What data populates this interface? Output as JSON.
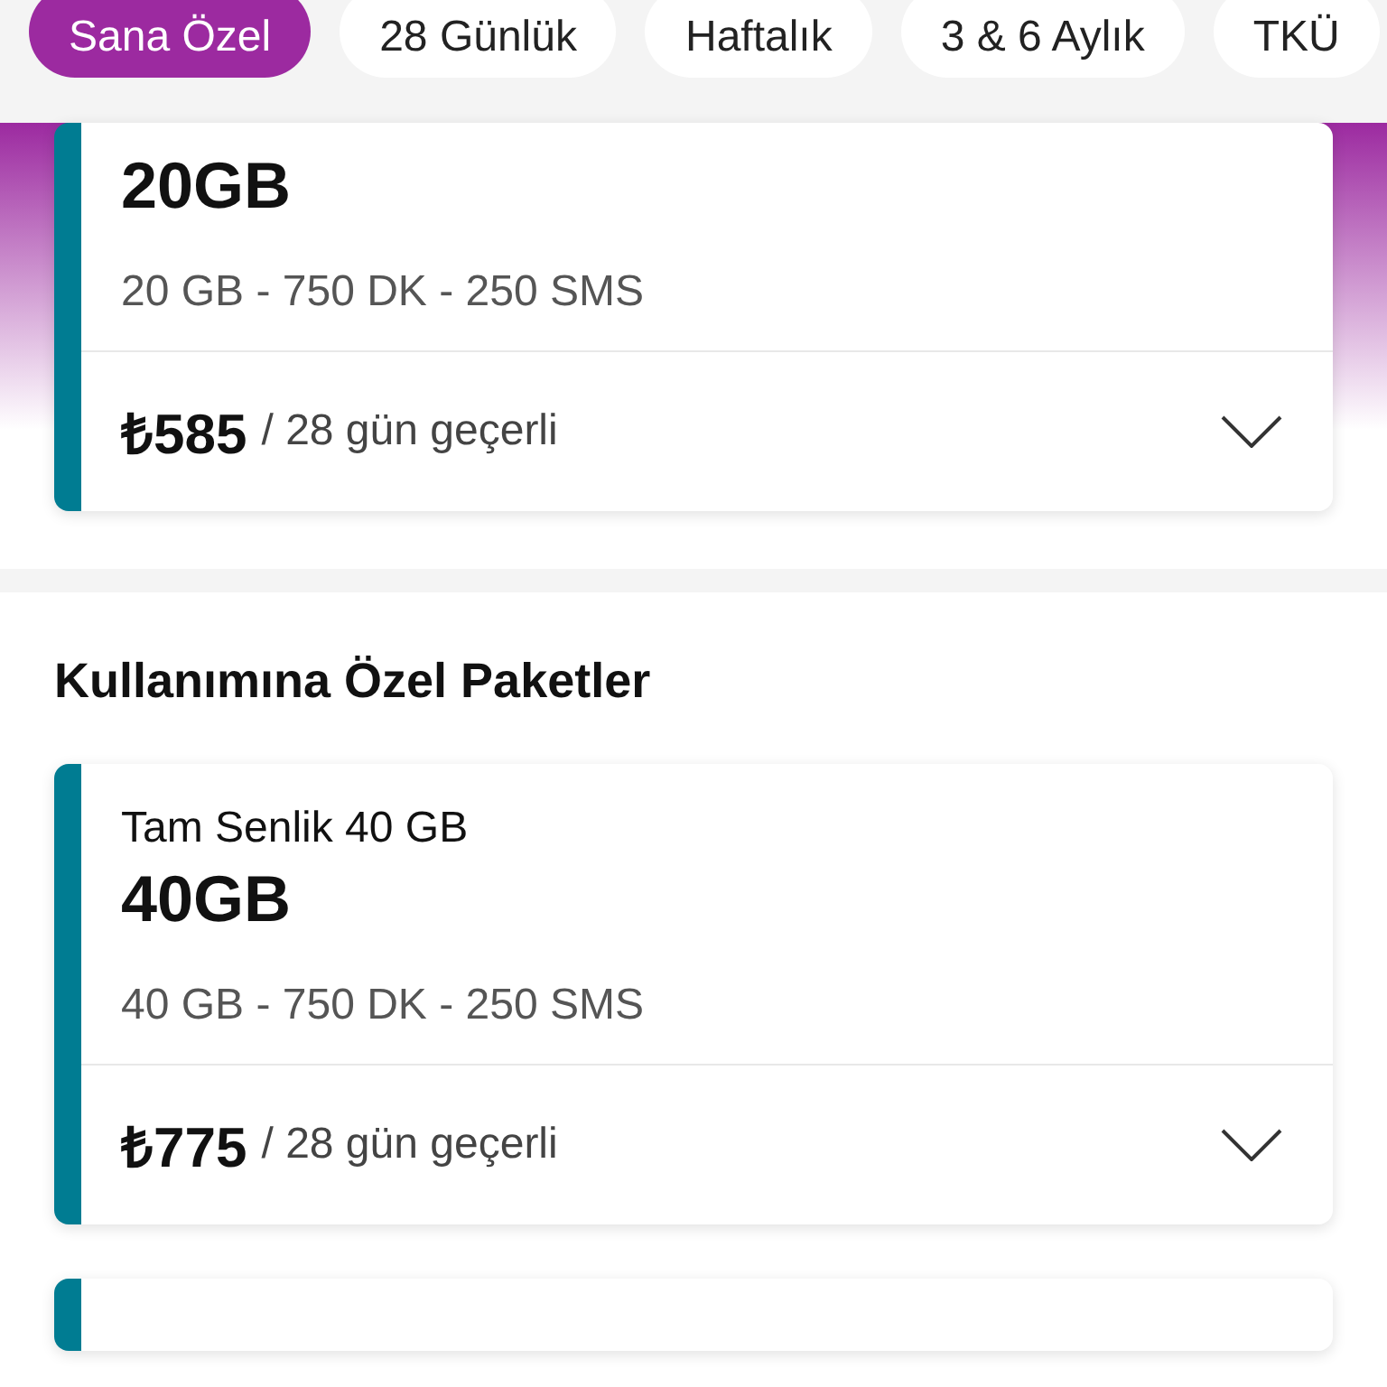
{
  "tabs": [
    {
      "label": "Sana Özel",
      "selected": true
    },
    {
      "label": "28 Günlük",
      "selected": false
    },
    {
      "label": "Haftalık",
      "selected": false
    },
    {
      "label": "3 & 6 Aylık",
      "selected": false
    },
    {
      "label": "TKÜ",
      "selected": false
    }
  ],
  "sections": [
    {
      "packages": [
        {
          "title": "20GB",
          "details": "20 GB - 750 DK - 250 SMS",
          "price": "₺585",
          "validity": "/ 28 gün geçerli"
        }
      ]
    },
    {
      "heading": "Kullanımına Özel Paketler",
      "packages": [
        {
          "name": "Tam Senlik 40 GB",
          "title": "40GB",
          "details": "40 GB - 750 DK - 250 SMS",
          "price": "₺775",
          "validity": "/ 28 gün geçerli"
        }
      ]
    }
  ]
}
